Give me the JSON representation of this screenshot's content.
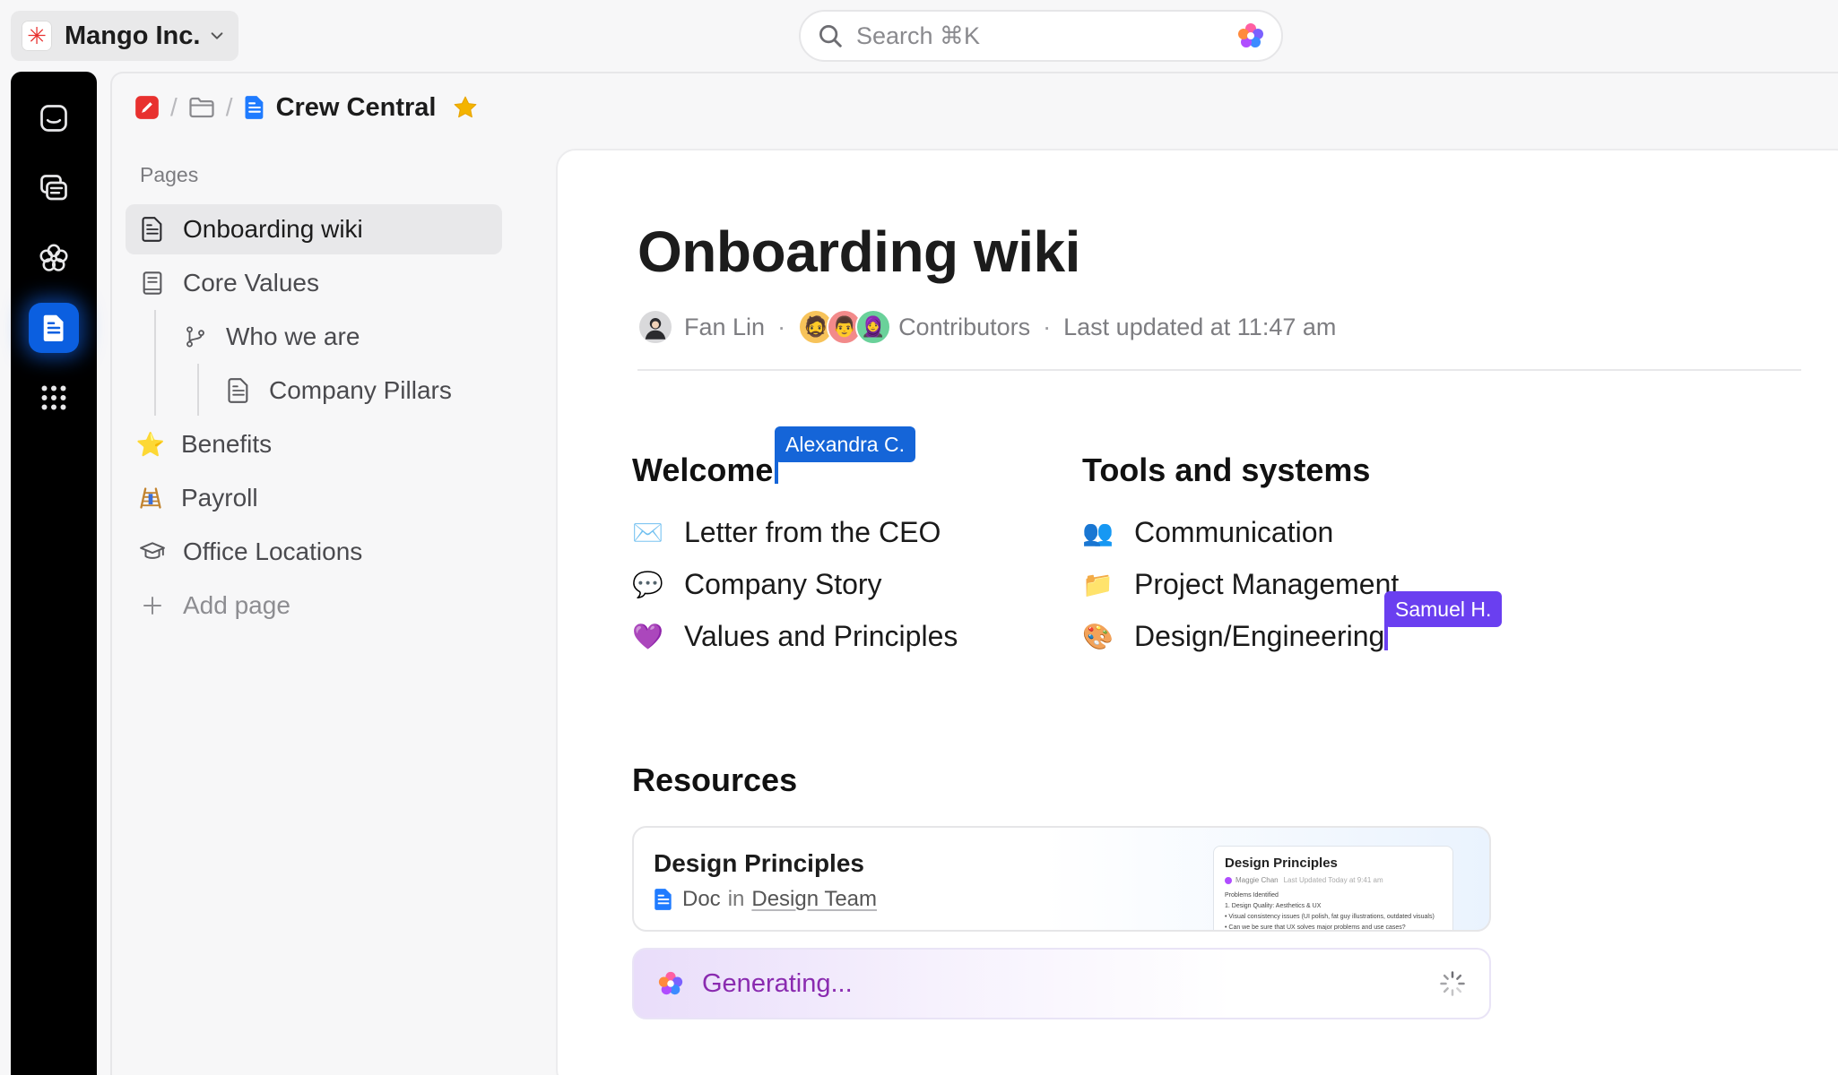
{
  "workspace": {
    "name": "Mango Inc."
  },
  "search": {
    "placeholder": "Search ⌘K"
  },
  "breadcrumb": {
    "title": "Crew Central"
  },
  "sidebar": {
    "section_label": "Pages",
    "items": [
      {
        "label": "Onboarding wiki",
        "icon": "doc-icon"
      },
      {
        "label": "Core Values",
        "icon": "book-icon"
      },
      {
        "label": "Who we are",
        "icon": "branch-icon"
      },
      {
        "label": "Company Pillars",
        "icon": "doc-icon"
      },
      {
        "label": "Benefits",
        "icon": "star-emoji"
      },
      {
        "label": "Payroll",
        "icon": "ladder-emoji"
      },
      {
        "label": "Office Locations",
        "icon": "graduation-cap-icon"
      }
    ],
    "add_page": "Add page"
  },
  "doc": {
    "title": "Onboarding wiki",
    "author": "Fan Lin",
    "contributors_label": "Contributors",
    "updated": "Last updated at 11:47 am"
  },
  "welcome": {
    "heading": "Welcome",
    "items": [
      {
        "emoji": "✉️",
        "label": "Letter from the CEO"
      },
      {
        "emoji": "💬",
        "label": "Company Story"
      },
      {
        "emoji": "💜",
        "label": "Values and Principles"
      }
    ]
  },
  "tools": {
    "heading": "Tools and systems",
    "items": [
      {
        "emoji": "👥",
        "label": "Communication"
      },
      {
        "emoji": "📁",
        "label": "Project Management"
      },
      {
        "emoji": "🎨",
        "label": "Design/Engineering"
      }
    ]
  },
  "cursors": {
    "alexandra": {
      "name": "Alexandra C.",
      "color": "#1565d8"
    },
    "samuel": {
      "name": "Samuel H.",
      "color": "#6a3ff0"
    }
  },
  "resources": {
    "heading": "Resources",
    "card": {
      "title": "Design Principles",
      "type": "Doc",
      "in": "in",
      "team": "Design Team",
      "thumb_title": "Design Principles",
      "thumb_author": "Maggie Chan",
      "thumb_updated": "Last Updated Today at 9:41 am",
      "thumb_lines": [
        "Problems Identified",
        "1. Design Quality: Aesthetics & UX",
        "• Visual consistency issues (UI polish, fat guy illustrations, outdated visuals)",
        "• Can we be sure that UX solves major problems and use cases?"
      ]
    },
    "generating": "Generating..."
  },
  "colors": {
    "brand_red": "#e8312f",
    "accent_blue": "#0b5fe0",
    "generating_purple": "#8a2bb0"
  }
}
